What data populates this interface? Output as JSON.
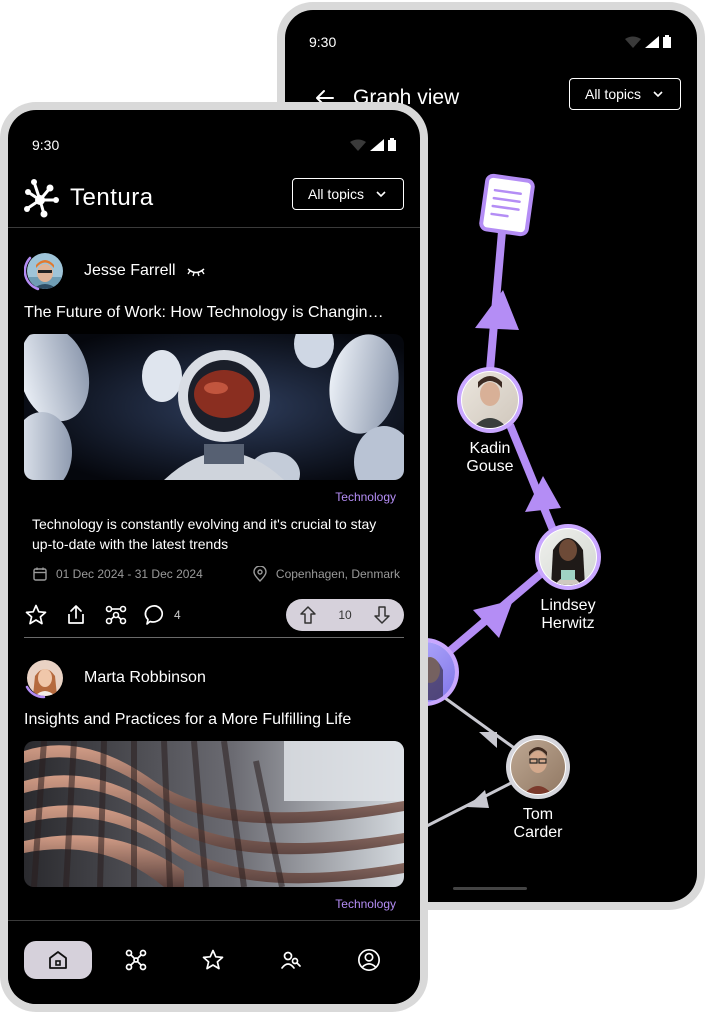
{
  "back_phone": {
    "status_time": "9:30",
    "title": "Graph view",
    "topic_select": "All topics",
    "nodes": [
      {
        "name": "Kadin\nGouse",
        "line1": "Kadin",
        "line2": "Gouse"
      },
      {
        "name": "Lindsey\nHerwitz",
        "line1": "Lindsey",
        "line2": "Herwitz"
      },
      {
        "name": "Tom\nCarder",
        "line1": "Tom",
        "line2": "Carder"
      }
    ],
    "icons": {
      "back": "arrow-left-icon",
      "document": "document-icon"
    }
  },
  "front_phone": {
    "status_time": "9:30",
    "brand": "Tentura",
    "topic_select": "All topics",
    "posts": [
      {
        "author": "Jesse Farrell",
        "title": "The Future of Work: How Technology is Changin…",
        "tag": "Technology",
        "description": "Technology is constantly evolving and it's crucial to stay up-to-date with the latest trends",
        "dates": "01 Dec 2024 - 31 Dec 2024",
        "location": "Copenhagen, Denmark",
        "comments": "4",
        "votes": "10"
      },
      {
        "author": "Marta Robbinson",
        "title": "Insights and Practices for a More Fulfilling Life",
        "tag": "Technology"
      }
    ],
    "nav": [
      "home-icon",
      "graph-icon",
      "star-icon",
      "friends-icon",
      "profile-icon"
    ]
  },
  "colors": {
    "accent": "#b48df5",
    "node_ring": "#c9a7ff",
    "edge_gray": "#c8c8d0",
    "pill": "#d6d1db"
  }
}
